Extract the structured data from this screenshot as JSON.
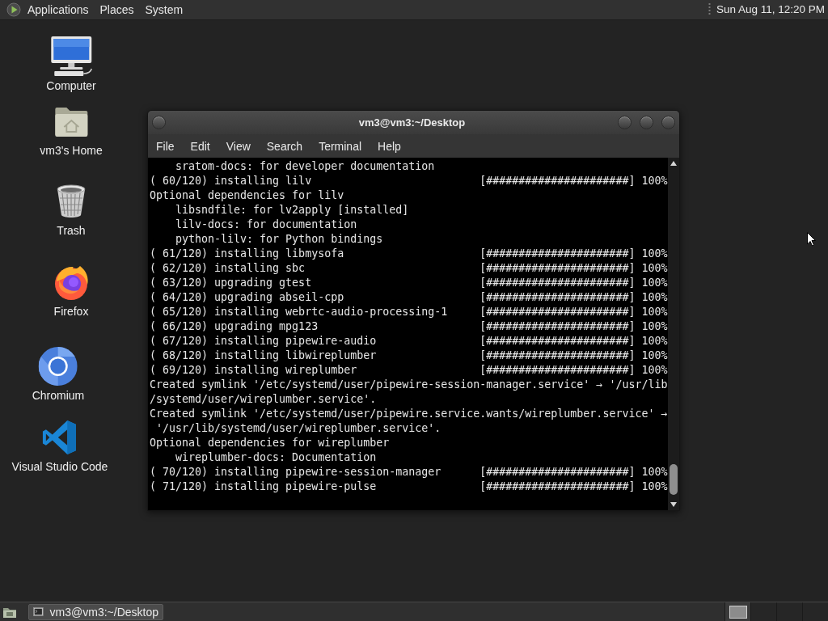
{
  "top_panel": {
    "menus": [
      "Applications",
      "Places",
      "System"
    ],
    "clock": "Sun Aug 11, 12:20 PM"
  },
  "desktop_icons": [
    {
      "kind": "computer",
      "label": "Computer"
    },
    {
      "kind": "home",
      "label": "vm3's Home"
    },
    {
      "kind": "trash",
      "label": "Trash"
    },
    {
      "kind": "firefox",
      "label": "Firefox"
    },
    {
      "kind": "chromium",
      "label": "Chromium"
    },
    {
      "kind": "vscode",
      "label": "Visual Studio Code"
    }
  ],
  "terminal_window": {
    "title": "vm3@vm3:~/Desktop",
    "menu": [
      "File",
      "Edit",
      "View",
      "Search",
      "Terminal",
      "Help"
    ],
    "lines": [
      {
        "kind": "detail",
        "text": "sratom-docs: for developer documentation"
      },
      {
        "kind": "progress",
        "text": "( 60/120) installing lilv",
        "bar": "[######################]",
        "percent": "100%"
      },
      {
        "kind": "plain",
        "text": "Optional dependencies for lilv"
      },
      {
        "kind": "detail",
        "text": "libsndfile: for lv2apply [installed]"
      },
      {
        "kind": "detail",
        "text": "lilv-docs: for documentation"
      },
      {
        "kind": "detail",
        "text": "python-lilv: for Python bindings"
      },
      {
        "kind": "progress",
        "text": "( 61/120) installing libmysofa",
        "bar": "[######################]",
        "percent": "100%"
      },
      {
        "kind": "progress",
        "text": "( 62/120) installing sbc",
        "bar": "[######################]",
        "percent": "100%"
      },
      {
        "kind": "progress",
        "text": "( 63/120) upgrading gtest",
        "bar": "[######################]",
        "percent": "100%"
      },
      {
        "kind": "progress",
        "text": "( 64/120) upgrading abseil-cpp",
        "bar": "[######################]",
        "percent": "100%"
      },
      {
        "kind": "progress",
        "text": "( 65/120) installing webrtc-audio-processing-1",
        "bar": "[######################]",
        "percent": "100%"
      },
      {
        "kind": "progress",
        "text": "( 66/120) upgrading mpg123",
        "bar": "[######################]",
        "percent": "100%"
      },
      {
        "kind": "progress",
        "text": "( 67/120) installing pipewire-audio",
        "bar": "[######################]",
        "percent": "100%"
      },
      {
        "kind": "progress",
        "text": "( 68/120) installing libwireplumber",
        "bar": "[######################]",
        "percent": "100%"
      },
      {
        "kind": "progress",
        "text": "( 69/120) installing wireplumber",
        "bar": "[######################]",
        "percent": "100%"
      },
      {
        "kind": "plain",
        "text": "Created symlink '/etc/systemd/user/pipewire-session-manager.service' → '/usr/lib"
      },
      {
        "kind": "plain",
        "text": "/systemd/user/wireplumber.service'."
      },
      {
        "kind": "plain",
        "text": "Created symlink '/etc/systemd/user/pipewire.service.wants/wireplumber.service' →"
      },
      {
        "kind": "plain",
        "text": " '/usr/lib/systemd/user/wireplumber.service'."
      },
      {
        "kind": "plain",
        "text": "Optional dependencies for wireplumber"
      },
      {
        "kind": "detail",
        "text": "wireplumber-docs: Documentation"
      },
      {
        "kind": "progress",
        "text": "( 70/120) installing pipewire-session-manager",
        "bar": "[######################]",
        "percent": "100%"
      },
      {
        "kind": "progress",
        "text": "( 71/120) installing pipewire-pulse",
        "bar": "[######################]",
        "percent": "100%"
      }
    ]
  },
  "bottom_panel": {
    "tasks": [
      {
        "label": "vm3@vm3:~/Desktop",
        "selected": true
      }
    ],
    "workspaces": [
      {
        "selected": true,
        "occupied": true
      },
      {
        "selected": false,
        "occupied": false
      },
      {
        "selected": false,
        "occupied": false
      },
      {
        "selected": false,
        "occupied": false
      }
    ]
  }
}
